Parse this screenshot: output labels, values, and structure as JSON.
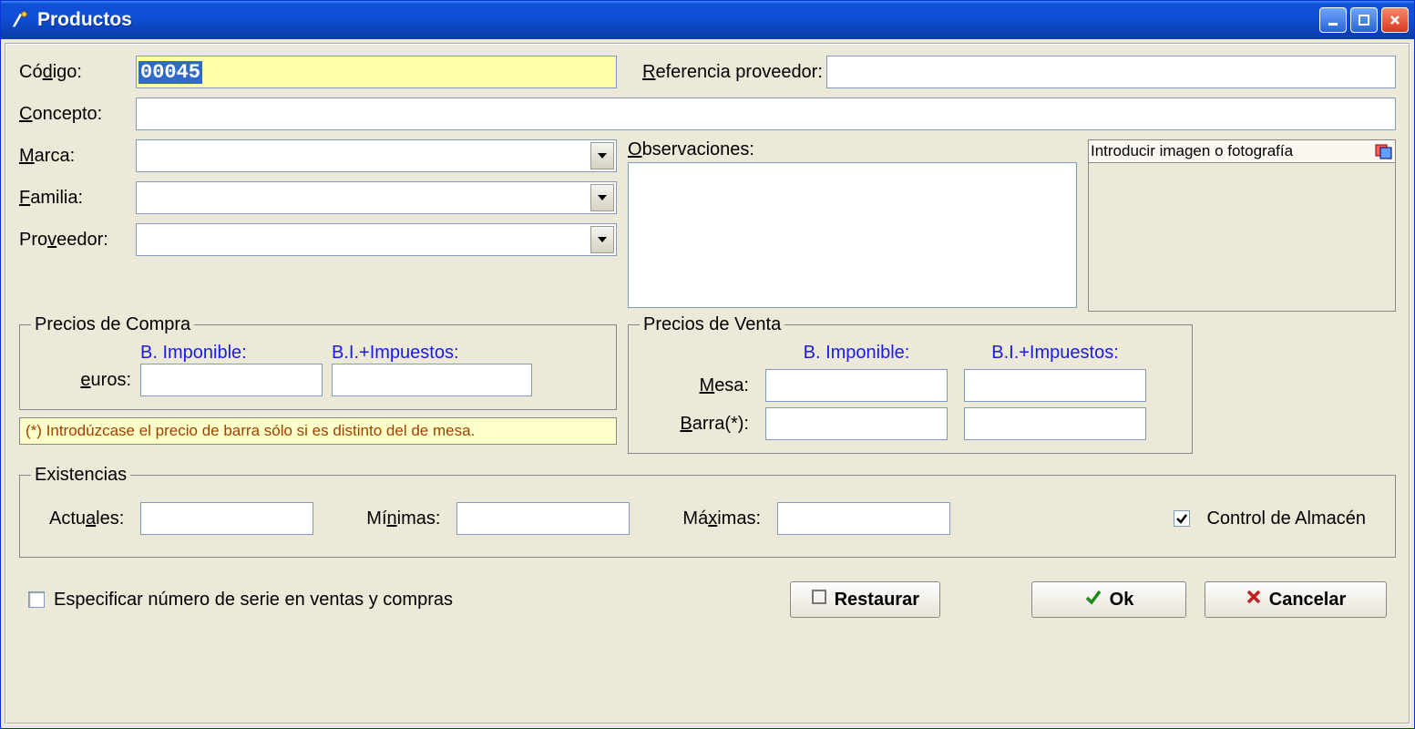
{
  "window": {
    "title": "Productos"
  },
  "labels": {
    "codigo": "Código:",
    "referencia": "Referencia proveedor:",
    "concepto": "Concepto:",
    "marca": "Marca:",
    "familia": "Familia:",
    "proveedor": "Proveedor:",
    "observaciones": "Observaciones:",
    "imagen_header": "Introducir imagen o fotografía",
    "precios_compra": "Precios de Compra",
    "precios_venta": "Precios de Venta",
    "b_imponible": "B. Imponible:",
    "bi_impuestos": "B.I.+Impuestos:",
    "euros": "euros:",
    "mesa": "Mesa:",
    "barra": "Barra(*):",
    "nota_barra": "(*) Introdúzcase el precio de barra sólo si es distinto del de mesa.",
    "existencias": "Existencias",
    "actuales": "Actuales:",
    "minimas": "Mínimas:",
    "maximas": "Máximas:",
    "control_almacen": "Control de Almacén",
    "especificar_serie": "Especificar número de serie en ventas y compras"
  },
  "values": {
    "codigo": "00045",
    "referencia": "",
    "concepto": "",
    "marca": "",
    "familia": "",
    "proveedor": "",
    "observaciones": "",
    "compra_bi": "",
    "compra_bii": "",
    "venta_mesa_bi": "",
    "venta_mesa_bii": "",
    "venta_barra_bi": "",
    "venta_barra_bii": "",
    "exist_actuales": "",
    "exist_minimas": "",
    "exist_maximas": ""
  },
  "checkboxes": {
    "control_almacen": true,
    "especificar_serie": false
  },
  "buttons": {
    "restaurar": "Restaurar",
    "ok": "Ok",
    "cancelar": "Cancelar"
  }
}
